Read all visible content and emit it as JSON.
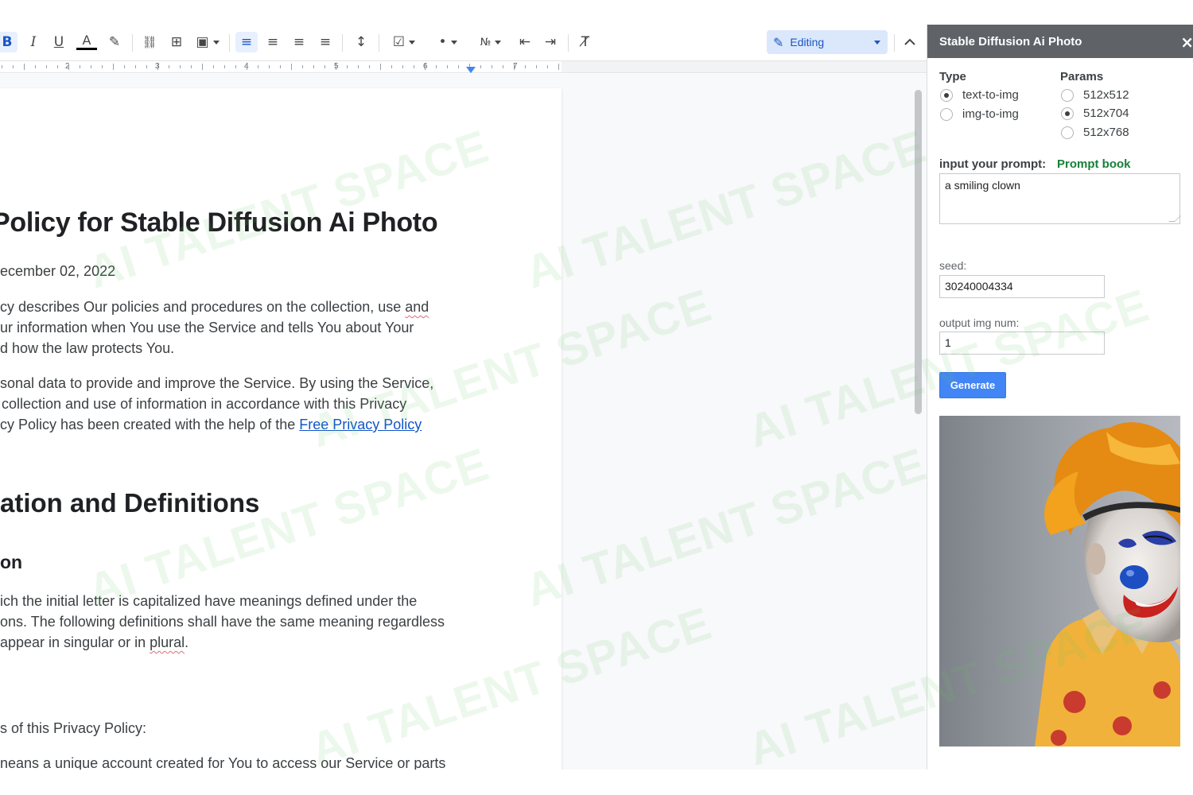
{
  "toolbar": {
    "buttons": [
      {
        "name": "bold-button",
        "glyph": "B"
      },
      {
        "name": "italic-button",
        "glyph": "I"
      },
      {
        "name": "underline-button",
        "glyph": "U"
      },
      {
        "name": "text-color-button",
        "glyph": "A"
      },
      {
        "name": "highlight-button",
        "glyph": "✎"
      },
      {
        "name": "insert-link-button",
        "glyph": "⛓"
      },
      {
        "name": "add-comment-button",
        "glyph": "⊞"
      },
      {
        "name": "insert-image-button",
        "glyph": "▣"
      },
      {
        "name": "align-left-button",
        "glyph": "≡"
      },
      {
        "name": "align-center-button",
        "glyph": "≡"
      },
      {
        "name": "align-right-button",
        "glyph": "≡"
      },
      {
        "name": "align-justify-button",
        "glyph": "≡"
      },
      {
        "name": "line-spacing-button",
        "glyph": "↕"
      },
      {
        "name": "checklist-button",
        "glyph": "☑"
      },
      {
        "name": "bulleted-list-button",
        "glyph": "•"
      },
      {
        "name": "numbered-list-button",
        "glyph": "№"
      },
      {
        "name": "decrease-indent-button",
        "glyph": "⇤"
      },
      {
        "name": "increase-indent-button",
        "glyph": "⇥"
      },
      {
        "name": "clear-formatting-button",
        "glyph": "T̸"
      }
    ],
    "mode_label": "Editing",
    "accent_color": "#1a56c5"
  },
  "ruler": {
    "numbers": [
      "2",
      "3",
      "4",
      "5",
      "6",
      "7"
    ]
  },
  "document": {
    "title": "Policy for Stable Diffusion Ai Photo",
    "date": "ecember 02, 2022",
    "para1": [
      {
        "text": "cy describes Our policies and procedures on the collection, use ",
        "tail": "and"
      },
      {
        "text": "ur information when You use the Service and tells You about Your",
        "tail": ""
      },
      {
        "text": "d how the law protects You.",
        "tail": ""
      }
    ],
    "para2": [
      "sonal data to provide and improve the Service. By using the Service,",
      "collection and use of information in accordance with this Privacy"
    ],
    "para2_last": "cy Policy has been created with the help of the ",
    "para2_link": "Free Privacy Policy",
    "heading2": "ation and Definitions",
    "heading3": "on",
    "para3": [
      "ich the initial letter is capitalized have meanings defined under the",
      "ons. The following definitions shall have the same meaning regardless"
    ],
    "para3_last": "appear in singular or in ",
    "para3_squiggle": "plural",
    "para3_end": ".",
    "para4": "s of this Privacy Policy:",
    "para5": "neans a unique account created for You to access our Service or parts"
  },
  "panel": {
    "title": "Stable Diffusion Ai Photo",
    "close_glyph": "×",
    "type_label": "Type",
    "type_options": [
      {
        "label": "text-to-img",
        "selected": true
      },
      {
        "label": "img-to-img",
        "selected": false
      }
    ],
    "params_label": "Params",
    "params_options": [
      {
        "label": "512x512",
        "selected": false
      },
      {
        "label": "512x704",
        "selected": true
      },
      {
        "label": "512x768",
        "selected": false
      }
    ],
    "prompt_label": "input your prompt:",
    "prompt_book_label": "Prompt book",
    "prompt_value": "a smiling clown",
    "seed_label": "seed:",
    "seed_value": "30240004334",
    "output_num_label": "output img num:",
    "output_num_value": "1",
    "generate_label": "Generate",
    "header_color": "#5f6368",
    "button_color": "#4285f4",
    "prompt_book_color": "#188038"
  },
  "watermark": {
    "text": "AI TALENT SPACE"
  }
}
